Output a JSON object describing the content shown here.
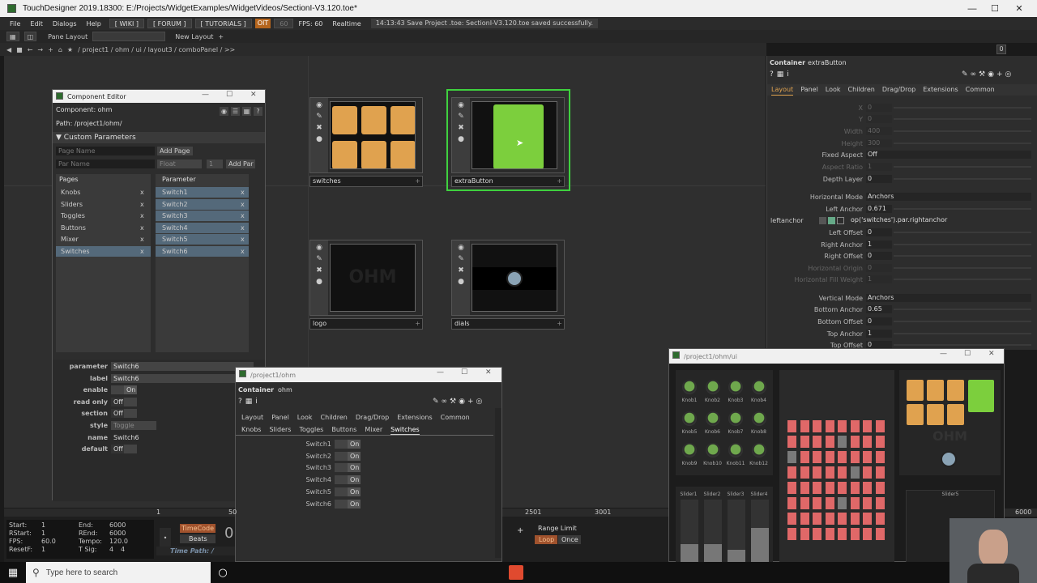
{
  "window": {
    "title": "TouchDesigner 2019.18300: E:/Projects/WidgetExamples/WidgetVideos/SectionI-V3.120.toe*"
  },
  "menu": {
    "items": [
      "File",
      "Edit",
      "Dialogs",
      "Help"
    ],
    "wiki": "[ WIKI ]",
    "forum": "[ FORUM ]",
    "tutorials": "[ TUTORIALS ]",
    "oit": "OIT",
    "fps_num": "60",
    "fps": "FPS: 60",
    "realtime": "Realtime",
    "status": "14:13:43 Save Project .toe: SectionI-V3.120.toe saved successfully."
  },
  "panebar": {
    "pane_layout": "Pane Layout",
    "new_layout": "New Layout"
  },
  "nav": {
    "path": "/ project1 / ohm / ui / layout3 / comboPanel / >>",
    "zero": "0"
  },
  "nodes": {
    "switches": "switches",
    "extraButton": "extraButton",
    "logo": "logo",
    "dials": "dials",
    "ohm": "OHM"
  },
  "component_editor": {
    "title": "Component Editor",
    "component": "Component: ohm",
    "path": "Path: /project1/ohm/",
    "custom_params": "Custom Parameters",
    "page_name_ph": "Page Name",
    "add_page": "Add Page",
    "par_name_ph": "Par Name",
    "float": "Float",
    "one": "1",
    "add_par": "Add Par",
    "pages_header": "Pages",
    "param_header": "Parameter",
    "pages": [
      "Knobs",
      "Sliders",
      "Toggles",
      "Buttons",
      "Mixer",
      "Switches"
    ],
    "params": [
      "Switch1",
      "Switch2",
      "Switch3",
      "Switch4",
      "Switch5",
      "Switch6"
    ],
    "x": "x",
    "props": {
      "parameter_l": "parameter",
      "parameter_v": "Switch6",
      "label_l": "label",
      "label_v": "Switch6",
      "enable_l": "enable",
      "enable_v": "On",
      "readonly_l": "read only",
      "readonly_v": "Off",
      "section_l": "section",
      "section_v": "Off",
      "style_l": "style",
      "style_v": "Toggle",
      "name_l": "name",
      "name_v": "Switch6",
      "default_l": "default",
      "default_v": "Off"
    }
  },
  "param_panel": {
    "type": "Container",
    "name": "extraButton",
    "tabs": [
      "Layout",
      "Panel",
      "Look",
      "Children",
      "Drag/Drop",
      "Extensions",
      "Common"
    ],
    "rows": [
      {
        "label": "X",
        "value": "0"
      },
      {
        "label": "Y",
        "value": "0"
      },
      {
        "label": "Width",
        "value": "400"
      },
      {
        "label": "Height",
        "value": "300"
      },
      {
        "label": "Fixed Aspect",
        "value": "Off"
      },
      {
        "label": "Aspect Ratio",
        "value": "1"
      },
      {
        "label": "Depth Layer",
        "value": "0"
      },
      {
        "label": "Horizontal Mode",
        "value": "Anchors"
      },
      {
        "label": "Left Anchor",
        "value": "0.671"
      },
      {
        "label": "leftanchor",
        "value": "op('switches').par.rightanchor"
      },
      {
        "label": "Left Offset",
        "value": "0"
      },
      {
        "label": "Right Anchor",
        "value": "1"
      },
      {
        "label": "Right Offset",
        "value": "0"
      },
      {
        "label": "Horizontal Origin",
        "value": "0"
      },
      {
        "label": "Horizontal Fill Weight",
        "value": "1"
      },
      {
        "label": "Vertical Mode",
        "value": "Anchors"
      },
      {
        "label": "Bottom Anchor",
        "value": "0.65"
      },
      {
        "label": "Bottom Offset",
        "value": "0"
      },
      {
        "label": "Top Anchor",
        "value": "1"
      },
      {
        "label": "Top Offset",
        "value": "0"
      }
    ]
  },
  "ohm_panel": {
    "title": "/project1/ohm",
    "type": "Container",
    "name": "ohm",
    "tabs": [
      "Layout",
      "Panel",
      "Look",
      "Children",
      "Drag/Drop",
      "Extensions",
      "Common"
    ],
    "subtabs": [
      "Knobs",
      "Sliders",
      "Toggles",
      "Buttons",
      "Mixer",
      "Switches"
    ],
    "switches": [
      "Switch1",
      "Switch2",
      "Switch3",
      "Switch4",
      "Switch5",
      "Switch6"
    ],
    "on": "On"
  },
  "ui_panel": {
    "title": "/project1/ohm/ui",
    "knobs": [
      "Knob1",
      "Knob2",
      "Knob3",
      "Knob4",
      "Knob5",
      "Knob6",
      "Knob7",
      "Knob8",
      "Knob9",
      "Knob10",
      "Knob11",
      "Knob12"
    ],
    "sliders": [
      "Slider1",
      "Slider2",
      "Slider3",
      "Slider4"
    ],
    "slider5": "Slider5",
    "logo": "OHM"
  },
  "timeline": {
    "start_l": "Start:",
    "start_v": "1",
    "end_l": "End:",
    "end_v": "6000",
    "rstart_l": "RStart:",
    "rstart_v": "1",
    "rend_l": "REnd:",
    "rend_v": "6000",
    "fps_l": "FPS:",
    "fps_v": "60.0",
    "tempo_l": "Tempo:",
    "tempo_v": "120.0",
    "reset_l": "ResetF:",
    "reset_v": "1",
    "tsig_l": "T Sig:",
    "tsig_v1": "4",
    "tsig_v2": "4",
    "timecode": "TimeCode",
    "beats": "Beats",
    "frame": "0",
    "timepath": "Time Path: /",
    "range_limit": "Range Limit",
    "loop": "Loop",
    "once": "Once",
    "m2501": "2501",
    "m3001": "3001",
    "m6000": "6000",
    "m1": "1",
    "m50": "50"
  },
  "taskbar": {
    "search": "Type here to search"
  }
}
